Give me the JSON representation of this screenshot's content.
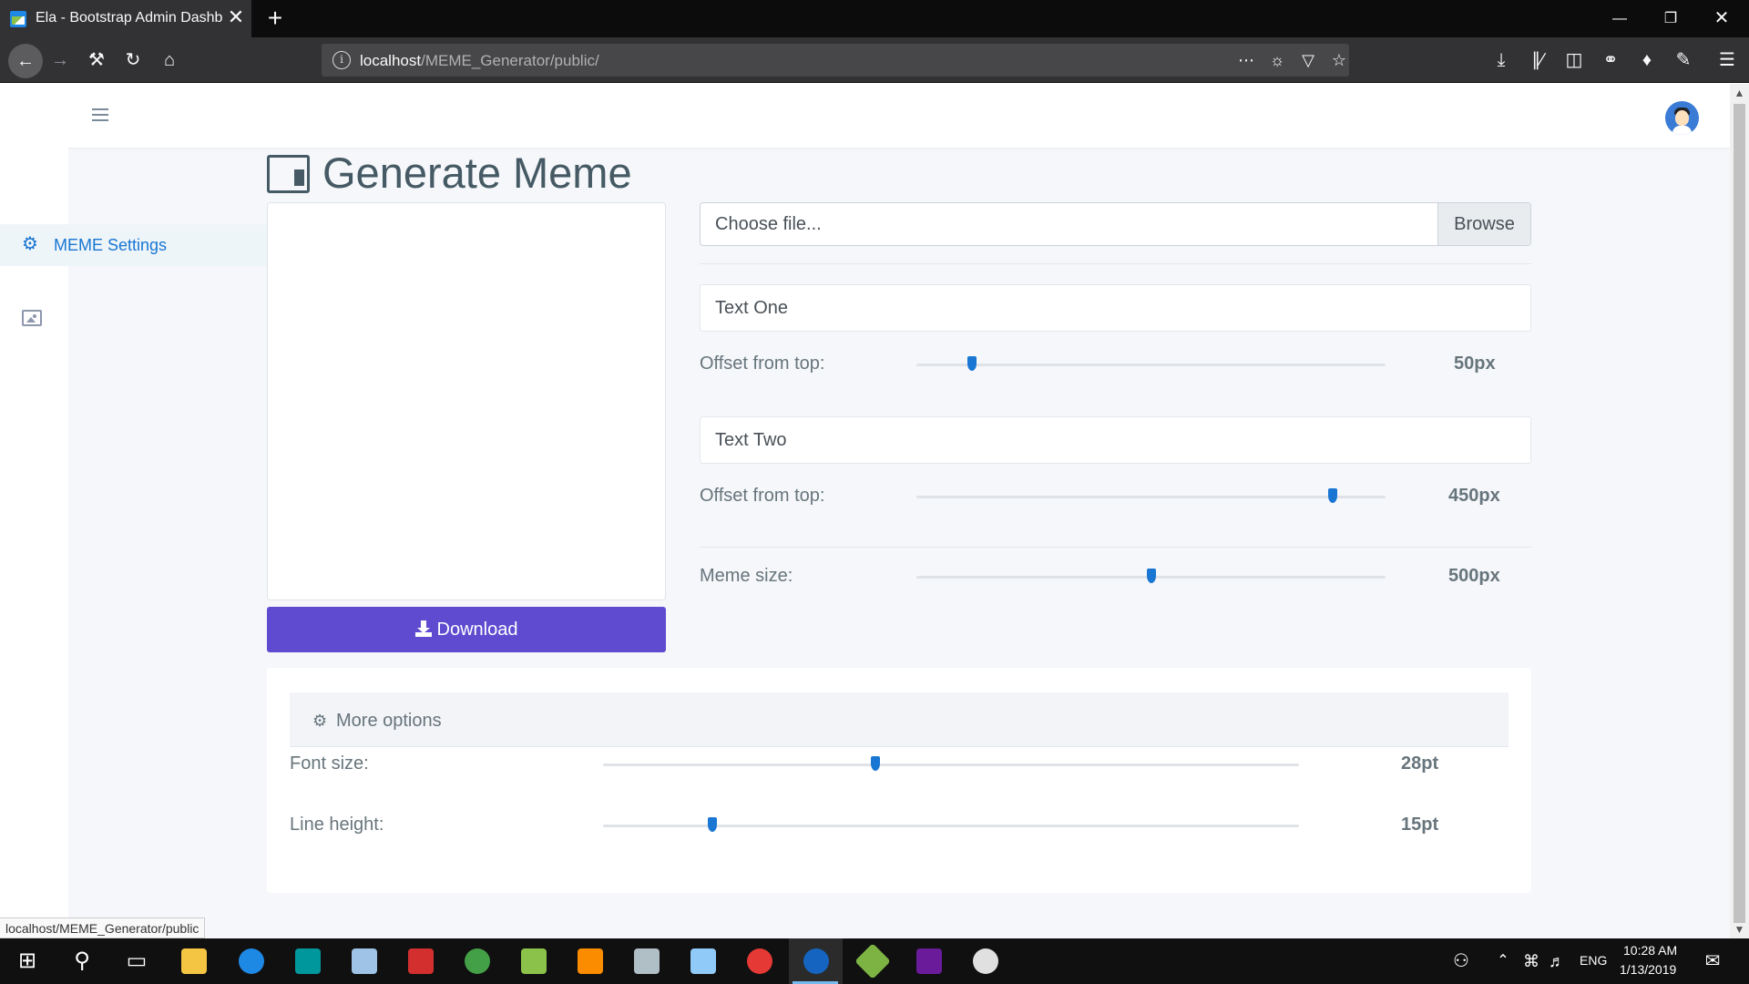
{
  "browser": {
    "tab_title": "Ela - Bootstrap Admin Dashboard",
    "tab_close": "✕",
    "new_tab": "+",
    "url_host": "localhost",
    "url_path": "/MEME_Generator/public/",
    "status_url": "localhost/MEME_Generator/public"
  },
  "sidebar": {
    "items": [
      {
        "label": "MEME Settings",
        "icon": "gear-icon",
        "active": true
      },
      {
        "label": "",
        "icon": "image-icon",
        "active": false
      }
    ]
  },
  "main": {
    "title": "Generate Meme",
    "file_input": {
      "placeholder": "Choose file...",
      "browse_label": "Browse"
    },
    "text_one": {
      "placeholder": "Text One",
      "offset_label": "Offset from top:",
      "offset_value": "50px",
      "offset_level": 0.1
    },
    "text_two": {
      "placeholder": "Text Two",
      "offset_label": "Offset from top:",
      "offset_value": "450px",
      "offset_level": 0.9
    },
    "meme_size": {
      "label": "Meme size:",
      "value": "500px",
      "level": 0.5
    },
    "download_label": "Download"
  },
  "more_options": {
    "title": "More options",
    "font_size": {
      "label": "Font size:",
      "value": "28pt",
      "level": 0.39
    },
    "line_height": {
      "label": "Line height:",
      "value": "15pt",
      "level": 0.15
    }
  },
  "taskbar": {
    "time": "10:28 AM",
    "date": "1/13/2019",
    "language": "ENG"
  },
  "colors": {
    "accent": "#1976d2",
    "download_button": "#5e4bd0",
    "heading": "#455a64"
  }
}
